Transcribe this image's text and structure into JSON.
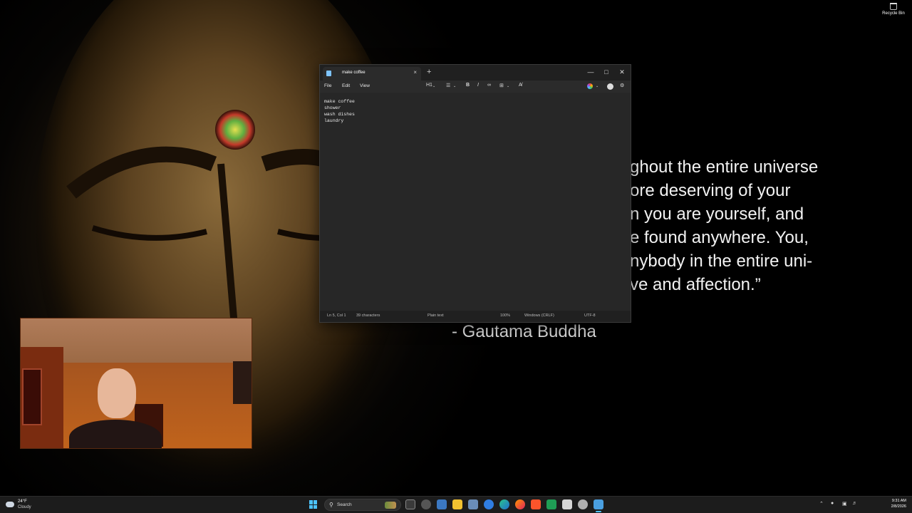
{
  "desktop": {
    "recycle_bin_label": "Recycle Bin",
    "quote_lines": [
      "ghout the entire universe",
      "ore deserving of your",
      "n you are yourself, and",
      "e found anywhere. You,",
      "nybody in the entire uni-",
      "ve and affection.”"
    ],
    "quote_author": "- Gautama Buddha"
  },
  "notepad": {
    "tab_title": "make coffee",
    "tab_close": "×",
    "new_tab": "+",
    "window_controls": {
      "minimize": "—",
      "maximize": "□",
      "close": "✕"
    },
    "menu": [
      "File",
      "Edit",
      "View"
    ],
    "toolbar": {
      "heading": "H1",
      "list": "☰",
      "bold": "B",
      "italic": "I",
      "link": "∞",
      "table": "⊞",
      "clear": "A̸"
    },
    "content_lines": [
      "make coffee",
      "shower",
      "wash dishes",
      "laundry"
    ],
    "status": {
      "position": "Ln 5, Col 1",
      "characters": "39 characters",
      "format": "Plain text",
      "zoom": "100%",
      "line_endings": "Windows (CRLF)",
      "encoding": "UTF-8"
    }
  },
  "taskbar": {
    "weather_temp": "24°F",
    "weather_condition": "Cloudy",
    "search_label": "Search",
    "clock_time": "9:31 AM",
    "clock_date": "2/8/2026",
    "accent_color": "#4cc2ff"
  }
}
